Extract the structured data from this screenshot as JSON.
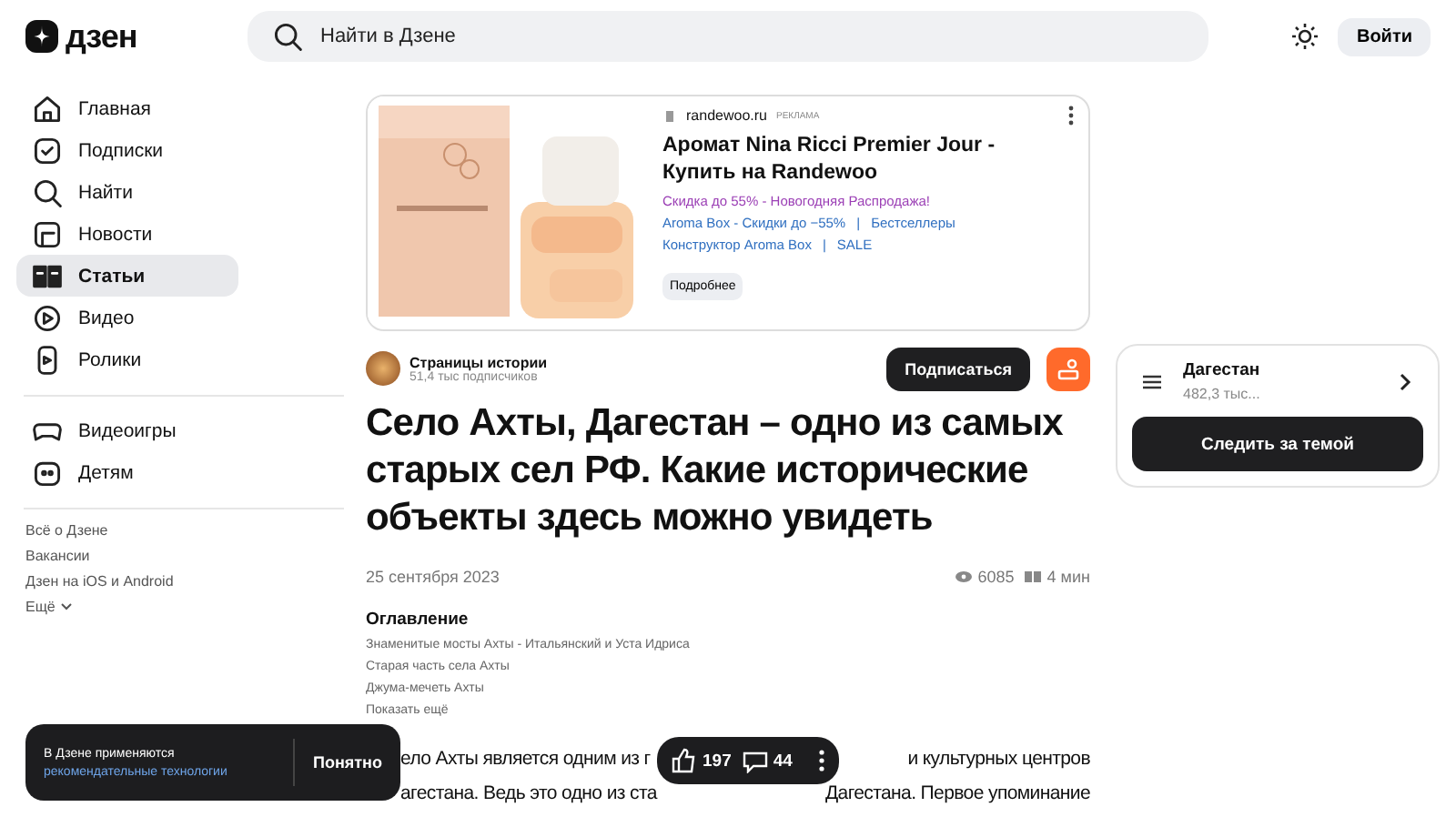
{
  "header": {
    "logo": "дзен",
    "search": {
      "placeholder": "Найти в Дзене"
    },
    "login": "Войти"
  },
  "sidebar": {
    "items": [
      {
        "label": "Главная",
        "selected": false
      },
      {
        "label": "Подписки",
        "selected": false
      },
      {
        "label": "Найти",
        "selected": false
      },
      {
        "label": "Новости",
        "selected": false
      },
      {
        "label": "Статьи",
        "selected": true
      },
      {
        "label": "Видео",
        "selected": false
      },
      {
        "label": "Ролики",
        "selected": false
      }
    ],
    "items2": [
      {
        "label": "Видеоигры",
        "selected": false
      },
      {
        "label": "Детям",
        "selected": false
      }
    ],
    "links": [
      "Всё о Дзене",
      "Вакансии",
      "Дзен на iOS и Android",
      "Ещё"
    ]
  },
  "ad": {
    "domain": "randewoo.ru",
    "tag": "РЕКЛАМА",
    "title": "Аромат Nina Ricci Premier Jour - Купить на Randewoo",
    "promo": "Скидка до 55% - Новогодняя Распродажа!",
    "links": [
      [
        "Aroma Box - Скидки до −55%",
        "Бестселлеры"
      ],
      [
        "Конструктор Aroma Box",
        "SALE"
      ]
    ],
    "separator": "|",
    "button": "Подробнее"
  },
  "channel": {
    "name": "Страницы истории",
    "subscribers": "51,4 тыс подписчиков",
    "subscribe": "Подписаться"
  },
  "article": {
    "title": "Село Ахты, Дагестан – одно из самых старых сел РФ. Какие исторические объекты здесь можно увидеть",
    "date": "25 сентября 2023",
    "views": "6085",
    "read_time": "4 мин",
    "toc": {
      "title": "Оглавление",
      "items": [
        "Знаменитые мосты Ахты - Итальянский и Уста Идриса",
        "Старая часть села Ахты",
        "Джума-мечеть Ахты"
      ],
      "more": "Показать ещё"
    },
    "body_lines": [
      [
        "ело Ахты является одним из г",
        "и культурных центров"
      ],
      [
        "агестана. Ведь это одно из ста",
        "Дагестана. Первое упоминание"
      ]
    ]
  },
  "topic": {
    "name": "Дагестан",
    "count": "482,3 тыс...",
    "follow": "Следить за темой"
  },
  "toast": {
    "text": "В Дзене применяются",
    "link": "рекомендательные технологии",
    "button": "Понятно"
  },
  "reactions": {
    "likes": "197",
    "comments": "44"
  }
}
